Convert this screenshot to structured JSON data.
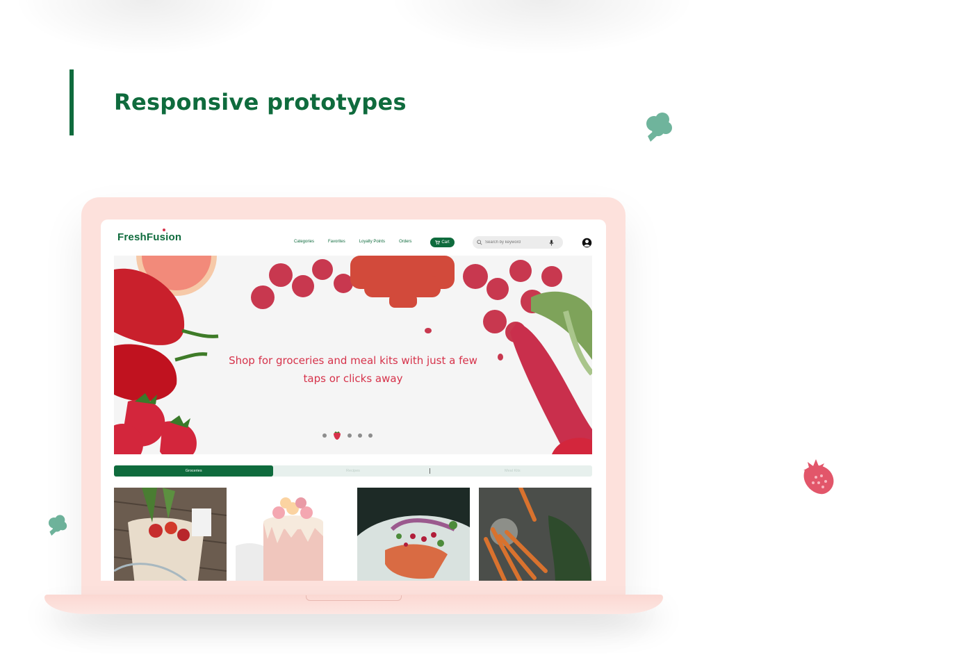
{
  "page": {
    "heading": "Responsive prototypes",
    "accent_color": "#0f6b3d",
    "decorations": [
      "broccoli-icon",
      "strawberry-icon",
      "broccoli-icon"
    ]
  },
  "site": {
    "logo": "FreshFusion",
    "nav": {
      "links": [
        "Categories",
        "Favorites",
        "Loyalty Points",
        "Orders"
      ],
      "cart_label": "Cart"
    },
    "search": {
      "placeholder": "Search by keyword"
    },
    "hero": {
      "line1": "Shop for groceries and meal kits with just a few",
      "line2": "taps or clicks away",
      "slide_count": 5,
      "active_slide": 2
    },
    "tabs": [
      "Groceries",
      "Recipes",
      "Meal Kits"
    ],
    "active_tab": "Groceries",
    "cards": [
      "grocery-bag-image",
      "layer-cake-image",
      "salmon-dish-image",
      "carrots-image"
    ],
    "colors": {
      "brand_green": "#0f6b3d",
      "accent_red": "#d6324a",
      "laptop_pink": "#fde1dc"
    }
  }
}
